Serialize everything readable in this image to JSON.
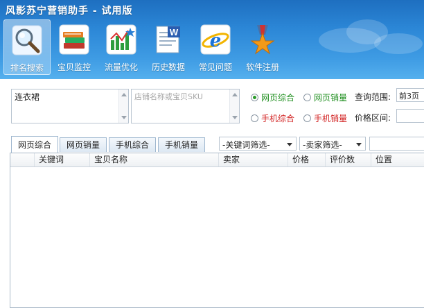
{
  "window": {
    "title": "风影苏宁营销助手 - 试用版"
  },
  "toolbar": {
    "items": [
      {
        "label": "排名搜索",
        "icon": "magnifier-icon",
        "active": true
      },
      {
        "label": "宝贝监控",
        "icon": "books-icon",
        "active": false
      },
      {
        "label": "流量优化",
        "icon": "bar-chart-icon",
        "active": false
      },
      {
        "label": "历史数据",
        "icon": "word-document-icon",
        "active": false
      },
      {
        "label": "常见问题",
        "icon": "ie-browser-icon",
        "active": false
      },
      {
        "label": "软件注册",
        "icon": "star-medal-icon",
        "active": false
      }
    ]
  },
  "search": {
    "keyword_value": "连衣裙",
    "sku_placeholder": "店铺名称或宝贝SKU",
    "radios": [
      {
        "label": "网页综合",
        "color": "green",
        "checked": true
      },
      {
        "label": "网页销量",
        "color": "green",
        "checked": false
      },
      {
        "label": "手机综合",
        "color": "red",
        "checked": false
      },
      {
        "label": "手机销量",
        "color": "red",
        "checked": false
      }
    ],
    "range_label": "查询范围:",
    "range_value": "前3页",
    "price_label": "价格区间:"
  },
  "tabs": [
    {
      "label": "网页综合",
      "active": true
    },
    {
      "label": "网页销量",
      "active": false
    },
    {
      "label": "手机综合",
      "active": false
    },
    {
      "label": "手机销量",
      "active": false
    }
  ],
  "filters": {
    "keyword_filter": "-关键词筛选-",
    "seller_filter": "-卖家筛选-"
  },
  "table": {
    "columns": [
      "关键词",
      "宝贝名称",
      "卖家",
      "价格",
      "评价数",
      "位置"
    ]
  },
  "colors": {
    "header_top": "#1e6fc0",
    "header_bottom": "#55b0ee",
    "green_option": "#1f8f1f",
    "red_option": "#d22121"
  }
}
